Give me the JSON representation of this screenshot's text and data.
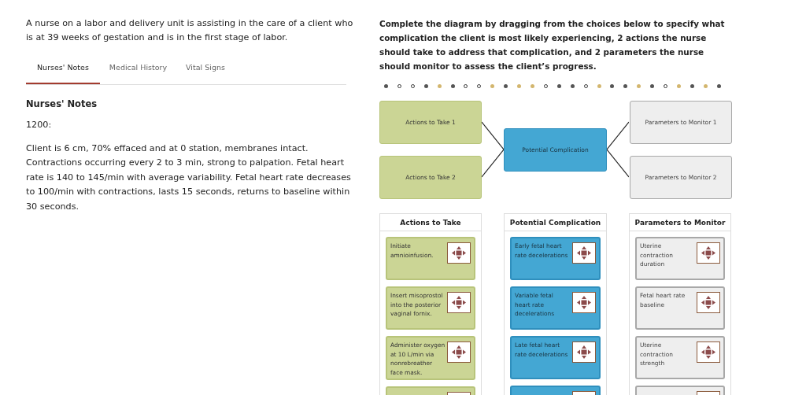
{
  "scenario": "A nurse on a labor and delivery unit is assisting in the care of a client who is at 39 weeks of gestation and is in the first stage of labor.",
  "tabs": [
    {
      "label": "Nurses' Notes",
      "selected": true
    },
    {
      "label": "Medical History",
      "selected": false
    },
    {
      "label": "Vital Signs",
      "selected": false
    }
  ],
  "notes": {
    "heading": "Nurses' Notes",
    "time": "1200:",
    "text": "Client is 6 cm, 70% effaced and at 0 station, membranes intact. Contractions occurring every 2 to 3 min, strong to palpation. Fetal heart rate is 140 to 145/min with average variability. Fetal heart rate decreases to 100/min with contractions, lasts 15 seconds, returns to baseline within 30 seconds."
  },
  "instructions": "Complete the diagram by dragging from the choices below to specify what complication the client is most likely experiencing, 2 actions the nurse should take to address that complication, and 2 parameters the nurse should monitor to assess the client’s progress.",
  "diagram": {
    "actions": [
      "Actions to Take 1",
      "Actions to Take 2"
    ],
    "complication": "Potential Complication",
    "parameters": [
      "Parameters to Monitor 1",
      "Parameters to Monitor 2"
    ]
  },
  "choice_columns": [
    {
      "kind": "action",
      "title": "Actions to Take",
      "options": [
        "Initiate amnioinfusion.",
        "Insert misoprostol into the posterior vaginal fornix.",
        "Administer oxygen at 10 L/min via nonrebreather face mask."
      ],
      "more_below": true
    },
    {
      "kind": "complication",
      "title": "Potential Complication",
      "options": [
        "Early fetal heart rate decelerations",
        "Variable fetal heart rate decelerations",
        "Late fetal heart rate decelerations"
      ],
      "more_below": true
    },
    {
      "kind": "parameter",
      "title": "Parameters to Monitor",
      "options": [
        "Uterine contraction duration",
        "Fetal heart rate baseline",
        "Uterine contraction strength"
      ],
      "more_below": true
    }
  ]
}
